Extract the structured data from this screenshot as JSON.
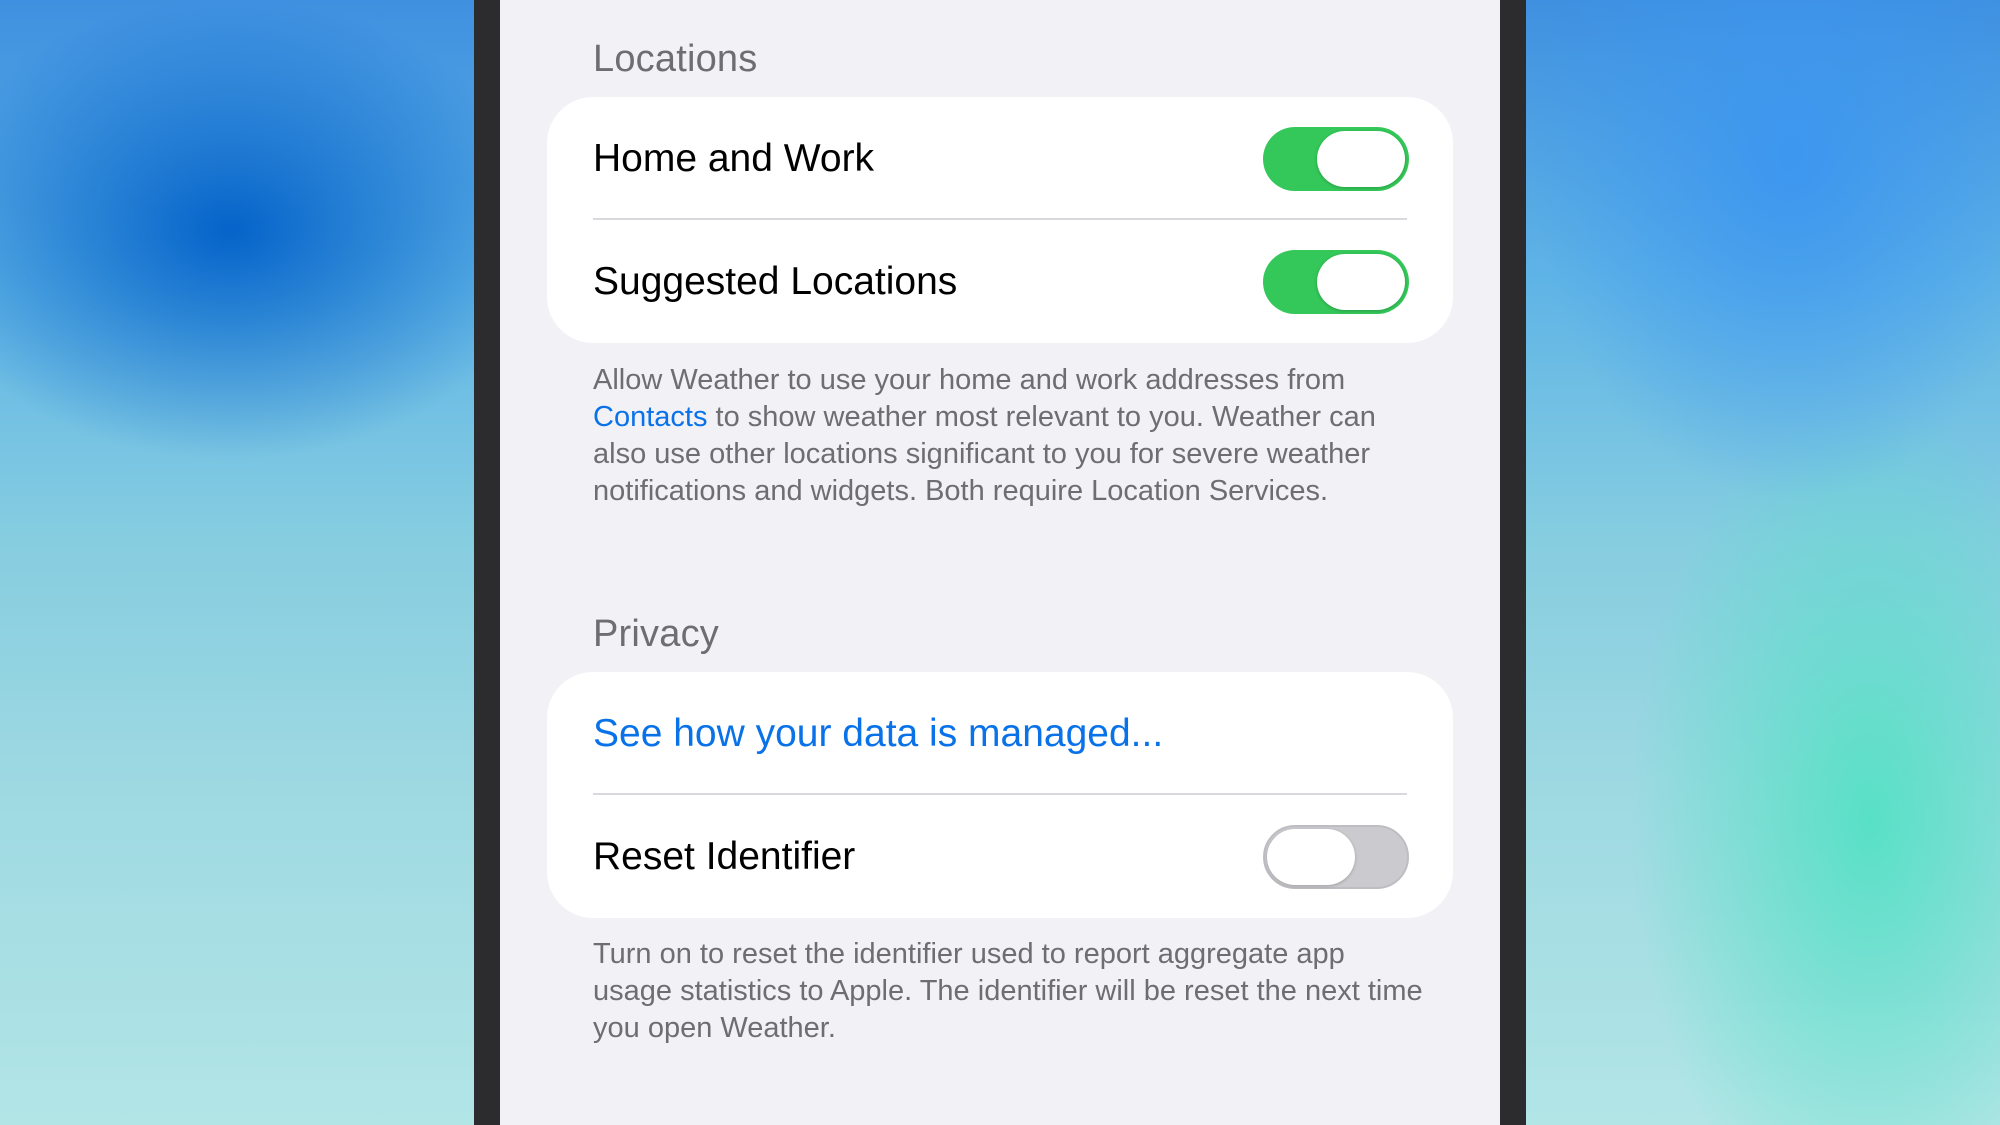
{
  "locations": {
    "header": "Locations",
    "rows": [
      {
        "label": "Home and Work",
        "toggle_on": true
      },
      {
        "label": "Suggested Locations",
        "toggle_on": true
      }
    ],
    "footer": {
      "part1": "Allow Weather to use your home and work addresses from ",
      "link": "Contacts",
      "part2": " to show weather most relevant to you. Weather can also use other locations significant to you for severe weather notifications and widgets. Both require Location Services."
    }
  },
  "privacy": {
    "header": "Privacy",
    "link_label": "See how your data is managed...",
    "reset_row": {
      "label": "Reset Identifier",
      "toggle_on": false
    },
    "footer": "Turn on to reset the identifier used to report aggregate app usage statistics to Apple. The identifier will be reset the next time you open Weather."
  },
  "colors": {
    "toggle_on": "#34c759",
    "toggle_off": "#cbcbcf",
    "link": "#0a72e8",
    "secondary_text": "#6d6d72",
    "screen_background": "#f1f1f6"
  }
}
